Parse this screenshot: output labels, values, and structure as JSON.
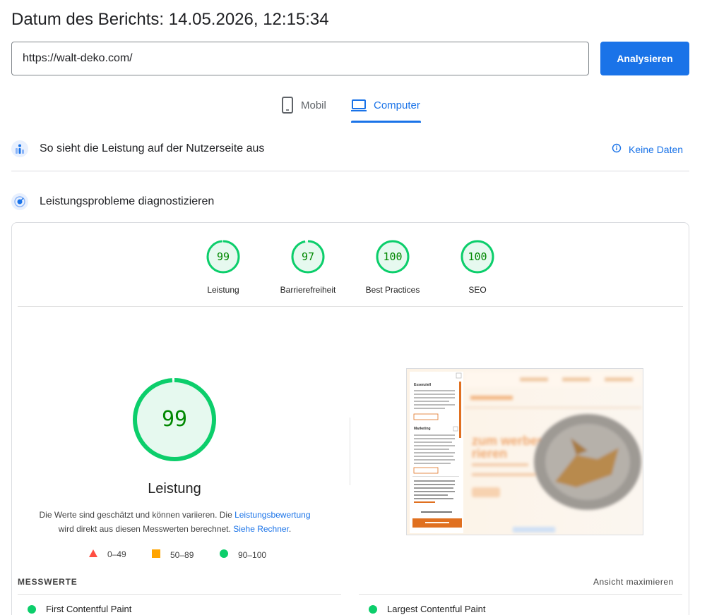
{
  "header": {
    "report_date": "Datum des Berichts: 14.05.2026, 12:15:34"
  },
  "url_bar": {
    "value": "https://walt-deko.com/",
    "analyze_label": "Analysieren"
  },
  "device_tabs": [
    {
      "label": "Mobil",
      "icon": "smartphone-icon",
      "active": false
    },
    {
      "label": "Computer",
      "icon": "laptop-icon",
      "active": true
    }
  ],
  "field_data": {
    "title": "So sieht die Leistung auf der Nutzerseite aus",
    "no_data_label": "Keine Daten",
    "icon": "people-chart-icon"
  },
  "diagnose": {
    "title": "Leistungsprobleme diagnostizieren",
    "icon": "radar-icon"
  },
  "categories": [
    {
      "label": "Leistung",
      "score": "99",
      "fraction": 0.99
    },
    {
      "label": "Barrierefreiheit",
      "score": "97",
      "fraction": 0.97
    },
    {
      "label": "Best Practices",
      "score": "100",
      "fraction": 1.0
    },
    {
      "label": "SEO",
      "score": "100",
      "fraction": 1.0
    }
  ],
  "performance": {
    "score": "99",
    "fraction": 0.99,
    "label": "Leistung",
    "disclaimer_pre": "Die Werte sind geschätzt und können variieren. Die ",
    "disclaimer_link1": "Leistungsbewertung",
    "disclaimer_mid": "wird direkt aus diesen Messwerten berechnet. ",
    "disclaimer_link2": "Siehe Rechner",
    "disclaimer_end": "."
  },
  "legend": [
    {
      "range": "0–49",
      "shape": "triangle",
      "color": "#ff4e42"
    },
    {
      "range": "50–89",
      "shape": "square",
      "color": "#ffa400"
    },
    {
      "range": "90–100",
      "shape": "circle",
      "color": "#0cce6b"
    }
  ],
  "metrics": {
    "title": "MESSWERTE",
    "expand_label": "Ansicht maximieren",
    "items": [
      {
        "label": "First Contentful Paint",
        "status": "good"
      },
      {
        "label": "Largest Contentful Paint",
        "status": "good"
      }
    ]
  },
  "colors": {
    "accent": "#1a73e8",
    "pass": "#0cce6b",
    "pass_text": "#008800",
    "pass_fill": "#e6f9ef"
  }
}
